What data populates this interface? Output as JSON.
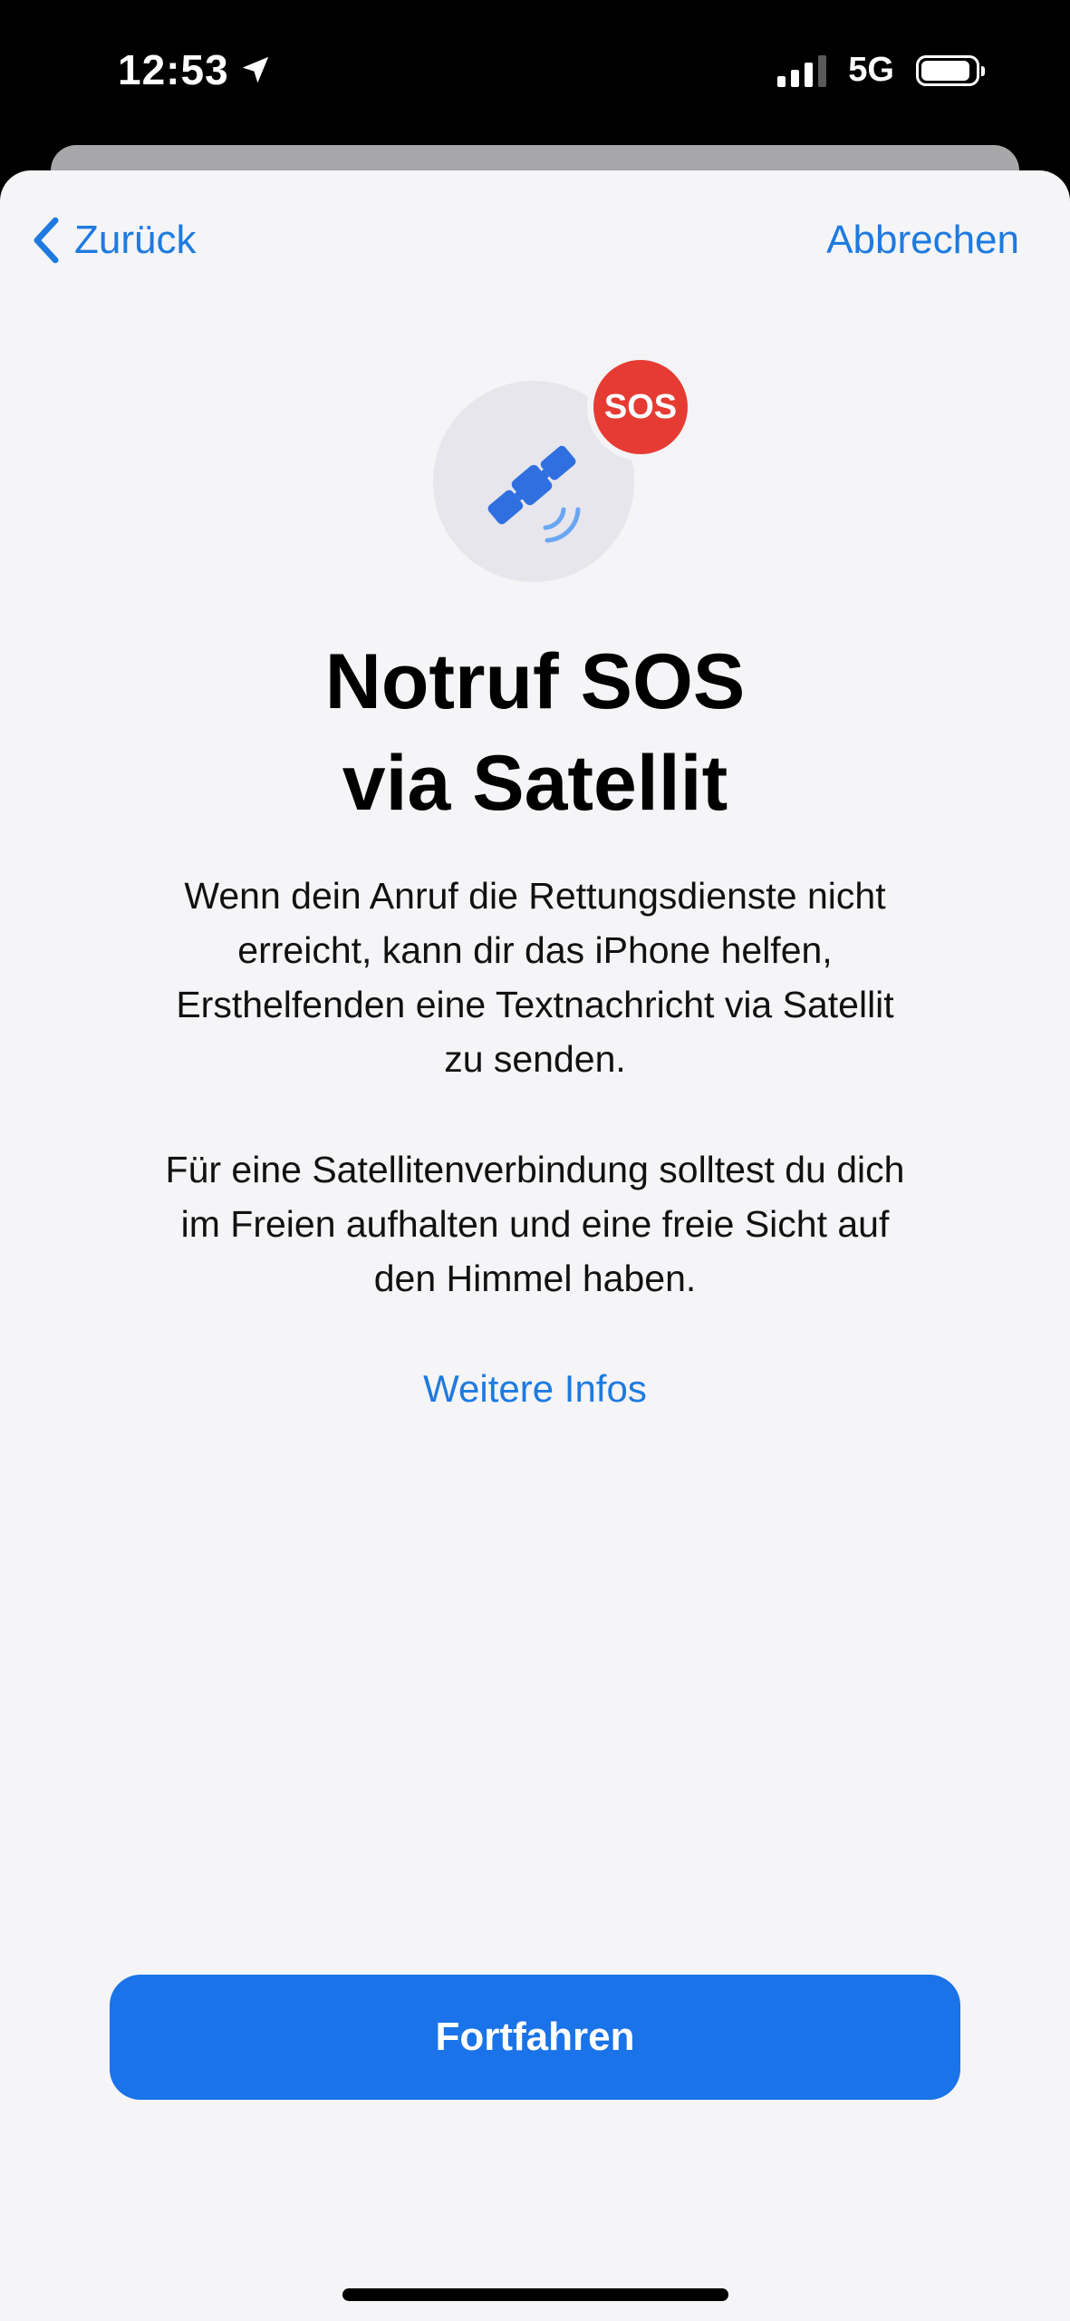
{
  "status_bar": {
    "time": "12:53",
    "network": "5G",
    "signal_bars": 3,
    "battery_level": 0.92
  },
  "nav": {
    "back_label": "Zurück",
    "cancel_label": "Abbrechen"
  },
  "hero": {
    "badge_text": "SOS"
  },
  "title": {
    "line1": "Notruf SOS",
    "line2": "via Satellit"
  },
  "body": {
    "paragraph1": [
      "Wenn dein Anruf die Rettungsdienste nicht",
      "erreicht, kann dir das iPhone helfen,",
      "Ersthelfenden eine Textnachricht via Satellit",
      "zu senden."
    ],
    "paragraph2": [
      "Für eine Satellitenverbindung solltest du dich",
      "im Freien aufhalten und eine freie Sicht auf",
      "den Himmel haben."
    ]
  },
  "more_info_label": "Weitere Infos",
  "continue_label": "Fortfahren",
  "colors": {
    "accent": "#1e7ae0",
    "button": "#1a73e8",
    "sos_red": "#e63b33",
    "sheet_bg": "#f5f5f7"
  }
}
